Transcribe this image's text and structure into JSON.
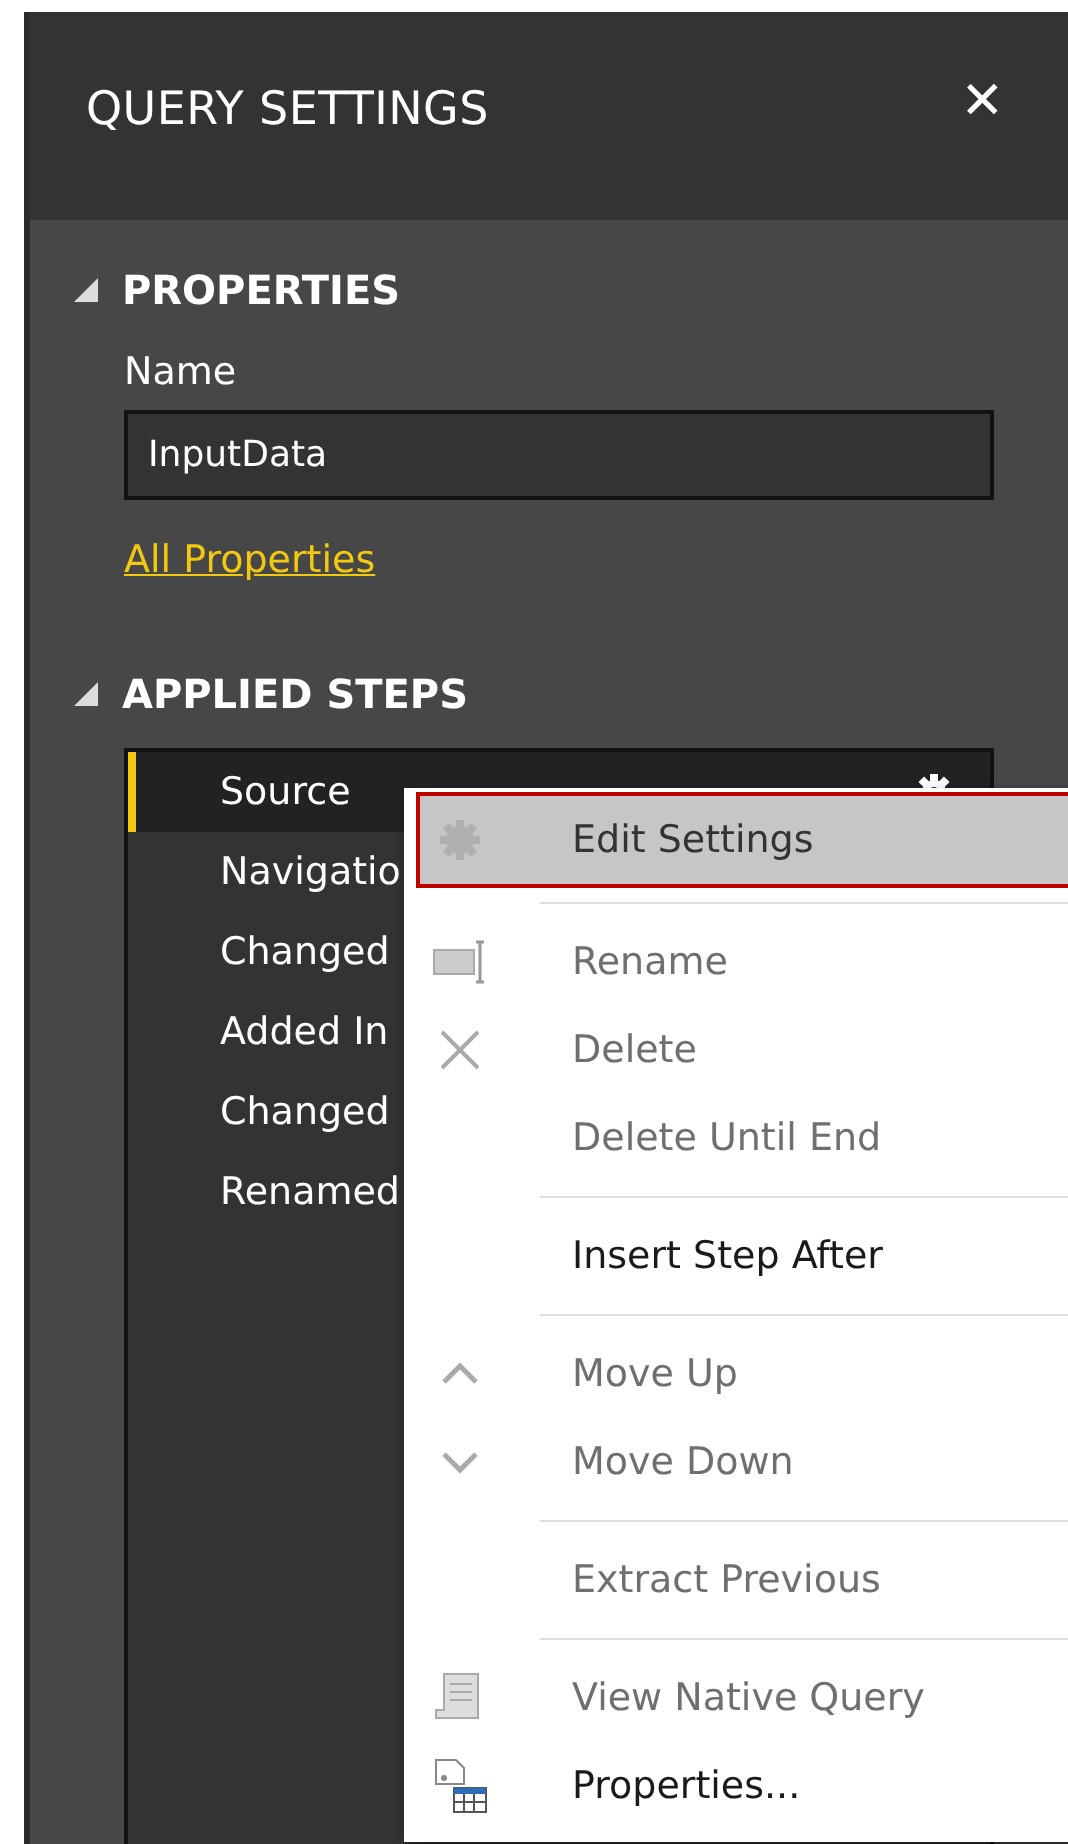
{
  "panel": {
    "title": "QUERY SETTINGS",
    "close": "✕"
  },
  "properties": {
    "heading": "PROPERTIES",
    "expanded": true,
    "name_label": "Name",
    "name_value": "InputData",
    "link": "All Properties"
  },
  "applied_steps": {
    "heading": "APPLIED STEPS",
    "expanded": true,
    "steps": [
      {
        "label": "Source",
        "selected": true
      },
      {
        "label": "Navigatio",
        "selected": false
      },
      {
        "label": "Changed",
        "selected": false
      },
      {
        "label": "Added In",
        "selected": false
      },
      {
        "label": "Changed",
        "selected": false
      },
      {
        "label": "Renamed",
        "selected": false
      }
    ]
  },
  "context_menu": {
    "items": [
      {
        "kind": "item",
        "label": "Edit Settings",
        "disabled": false,
        "highlighted": true
      },
      {
        "kind": "separator"
      },
      {
        "kind": "item",
        "label": "Rename",
        "disabled": true,
        "highlighted": false
      },
      {
        "kind": "item",
        "label": "Delete",
        "disabled": true,
        "highlighted": false
      },
      {
        "kind": "item",
        "label": "Delete Until End",
        "disabled": true,
        "highlighted": false
      },
      {
        "kind": "separator"
      },
      {
        "kind": "item",
        "label": "Insert Step After",
        "disabled": false,
        "highlighted": false
      },
      {
        "kind": "separator"
      },
      {
        "kind": "item",
        "label": "Move Up",
        "disabled": true,
        "highlighted": false
      },
      {
        "kind": "item",
        "label": "Move Down",
        "disabled": true,
        "highlighted": false
      },
      {
        "kind": "separator"
      },
      {
        "kind": "item",
        "label": "Extract Previous",
        "disabled": true,
        "highlighted": false
      },
      {
        "kind": "separator"
      },
      {
        "kind": "item",
        "label": "View Native Query",
        "disabled": true,
        "highlighted": false
      },
      {
        "kind": "item",
        "label": "Properties...",
        "disabled": false,
        "highlighted": false
      }
    ]
  }
}
